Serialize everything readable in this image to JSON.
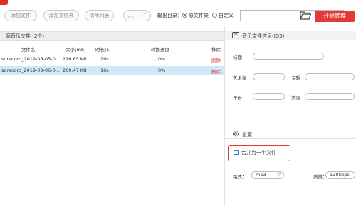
{
  "toolbar": {
    "add_file": "添加文件",
    "add_folder": "添加文件夹",
    "clear_list": "清除列表",
    "nav_up": "︿",
    "nav_down": "﹀",
    "output_label": "输出目录：",
    "source_folder": "原文件夹",
    "custom": "自定义",
    "path_value": "",
    "convert_button": "开始转换"
  },
  "left": {
    "header": "源音乐文件 (2个)",
    "columns": [
      "文件名",
      "大小(mb)",
      "时长(s)",
      "转换进度",
      "移除"
    ],
    "rows": [
      {
        "name": "sdrecord_2019-08-05-0...",
        "size": "226.65 KB",
        "duration": "29s",
        "progress": "0%",
        "remove": "删除"
      },
      {
        "name": "sdrecord_2019-08-06-0...",
        "size": "260.47 KB",
        "duration": "16s",
        "progress": "0%",
        "remove": "删除"
      }
    ]
  },
  "id3": {
    "title": "音乐文件信息(ID3)",
    "title_label": "标题",
    "artist_label": "艺术家",
    "album_label": "专辑",
    "year_label": "年份",
    "genre_label": "流派"
  },
  "settings": {
    "title": "设置",
    "merge_label": "合并为一个文件",
    "format_label": "格式：",
    "format_value": "mp3",
    "quality_label": "质量：",
    "quality_value": "128kbps"
  },
  "colors": {
    "accent_red": "#e53935",
    "selected_row": "#cfe9f8",
    "radio_blue": "#3a7bd5"
  }
}
